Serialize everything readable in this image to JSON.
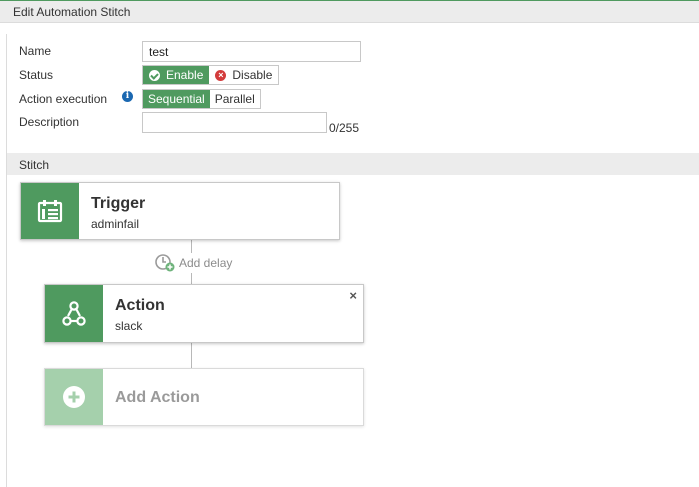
{
  "header": {
    "title": "Edit Automation Stitch"
  },
  "form": {
    "name_label": "Name",
    "name_value": "test",
    "status_label": "Status",
    "status_enable": "Enable",
    "status_disable": "Disable",
    "status_selected": "Enable",
    "exec_label": "Action execution",
    "exec_sequential": "Sequential",
    "exec_parallel": "Parallel",
    "exec_selected": "Sequential",
    "description_label": "Description",
    "description_value": "",
    "description_count": "0/255"
  },
  "stitch": {
    "section_label": "Stitch",
    "trigger": {
      "title": "Trigger",
      "subtitle": "adminfail",
      "icon": "calendar-icon"
    },
    "add_delay": {
      "label": "Add delay",
      "icon": "clock-plus-icon"
    },
    "action": {
      "title": "Action",
      "subtitle": "slack",
      "icon": "webhook-icon",
      "close": "×"
    },
    "add_action": {
      "title": "Add Action",
      "icon": "plus-circle-icon"
    }
  },
  "colors": {
    "accent": "#4f9a5f",
    "accent_light": "#a5d0ac",
    "info": "#1b68b1",
    "danger": "#d33b3b"
  }
}
